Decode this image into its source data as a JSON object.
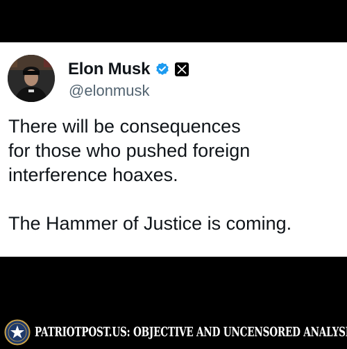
{
  "tweet": {
    "display_name": "Elon Musk",
    "handle": "@elonmusk",
    "lines": [
      "There will be consequences",
      "for those who pushed foreign",
      "interference hoaxes.",
      "The Hammer of Justice is coming."
    ],
    "verified_icon": "verified-badge-icon",
    "affiliation_icon": "x-logo-icon"
  },
  "footer": {
    "text": "PATRIOTPOST.US: OBJECTIVE AND UNCENSORED ANALYSIS",
    "emblem_icon": "star-emblem-icon"
  },
  "colors": {
    "background": "#000000",
    "card": "#ffffff",
    "text": "#0f1419",
    "handle": "#536471",
    "verified": "#1d9bf0"
  }
}
